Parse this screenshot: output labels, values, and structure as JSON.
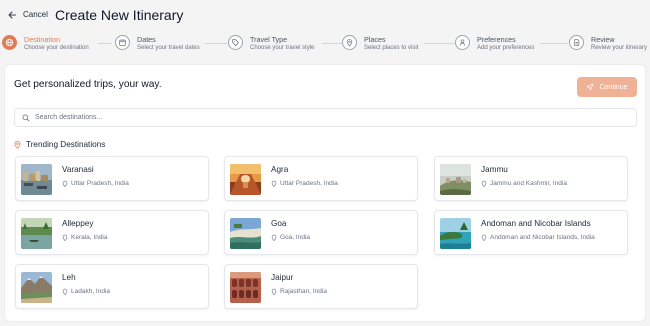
{
  "header": {
    "back_icon": "arrow-left-icon",
    "cancel_label": "Cancel",
    "title": "Create New Itinerary"
  },
  "stepper": {
    "active_color": "#e07d55",
    "steps": [
      {
        "title": "Destination",
        "subtitle": "Choose your destination",
        "icon": "globe-icon",
        "active": true
      },
      {
        "title": "Dates",
        "subtitle": "Select your travel dates",
        "icon": "calendar-icon",
        "active": false
      },
      {
        "title": "Travel Type",
        "subtitle": "Choose your travel style",
        "icon": "tag-icon",
        "active": false
      },
      {
        "title": "Places",
        "subtitle": "Select places to visit",
        "icon": "map-pin-icon",
        "active": false
      },
      {
        "title": "Preferences",
        "subtitle": "Add your preferences",
        "icon": "user-icon",
        "active": false
      },
      {
        "title": "Review",
        "subtitle": "Review your itinerary",
        "icon": "document-icon",
        "active": false
      }
    ]
  },
  "main": {
    "heading": "Get personalized trips, your way.",
    "continue_label": "Continue",
    "continue_icon": "send-icon",
    "continue_color": "#efb297",
    "search": {
      "placeholder": "Search destinations...",
      "icon": "search-icon"
    },
    "trending_label": "Trending Destinations",
    "trending_icon": "map-pin-icon",
    "destinations": [
      {
        "name": "Varanasi",
        "location": "Uttar Pradesh, India"
      },
      {
        "name": "Agra",
        "location": "Uttar Pradesh, India"
      },
      {
        "name": "Jammu",
        "location": "Jammu and Kashmir, India"
      },
      {
        "name": "Alleppey",
        "location": "Kerala, India"
      },
      {
        "name": "Goa",
        "location": "Goa, India"
      },
      {
        "name": "Andoman and Nicobar Islands",
        "location": "Andoman and Nicobar Islands, India"
      },
      {
        "name": "Leh",
        "location": "Ladakh, India"
      },
      {
        "name": "Jaipur",
        "location": "Rajasthan, India"
      }
    ]
  }
}
